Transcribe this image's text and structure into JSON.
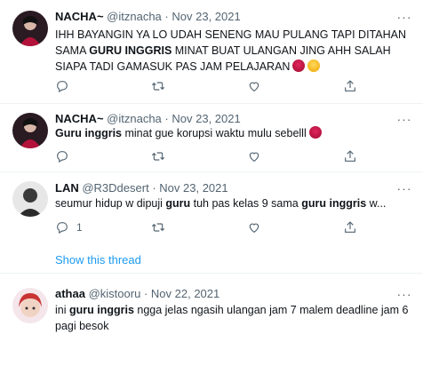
{
  "tweets": [
    {
      "name": "NACHA~",
      "handle": "@itznacha",
      "dot": "·",
      "date": "Nov 23, 2021",
      "text": [
        {
          "t": "IHH BAYANGIN YA LO UDAH SENENG MAU PULANG TAPI DITAHAN SAMA "
        },
        {
          "t": "GURU INGGRIS",
          "b": true
        },
        {
          "t": " MINAT BUAT ULANGAN JING AHH SALAH SIAPA TADI GAMASUK PAS JAM PELAJARAN"
        }
      ],
      "emojis": [
        "angry-face",
        "weary-face"
      ],
      "reply_count": "",
      "retweet_count": "",
      "like_count": ""
    },
    {
      "name": "NACHA~",
      "handle": "@itznacha",
      "dot": "·",
      "date": "Nov 23, 2021",
      "text": [
        {
          "t": "Guru inggris",
          "b": true
        },
        {
          "t": " minat gue korupsi waktu mulu sebelll"
        }
      ],
      "emojis": [
        "angry-face"
      ],
      "reply_count": "",
      "retweet_count": "",
      "like_count": ""
    },
    {
      "name": "LAN",
      "handle": "@R3Ddesert",
      "dot": "·",
      "date": "Nov 23, 2021",
      "text": [
        {
          "t": "seumur hidup w dipuji "
        },
        {
          "t": "guru",
          "b": true
        },
        {
          "t": " tuh pas kelas 9 sama "
        },
        {
          "t": "guru inggris",
          "b": true
        },
        {
          "t": " w..."
        }
      ],
      "emojis": [],
      "reply_count": "1",
      "retweet_count": "",
      "like_count": ""
    },
    {
      "name": "athaa",
      "handle": "@kistooru",
      "dot": "·",
      "date": "Nov 22, 2021",
      "text": [
        {
          "t": "ini "
        },
        {
          "t": "guru inggris",
          "b": true
        },
        {
          "t": " ngga jelas ngasih ulangan jam 7 malem deadline jam 6 pagi besok"
        }
      ],
      "emojis": [],
      "reply_count": "",
      "retweet_count": "",
      "like_count": ""
    }
  ],
  "show_thread": "Show this thread",
  "more_glyph": "···",
  "colors": {
    "link": "#1d9bf0",
    "muted": "#536471",
    "divider": "#eff3f4"
  }
}
